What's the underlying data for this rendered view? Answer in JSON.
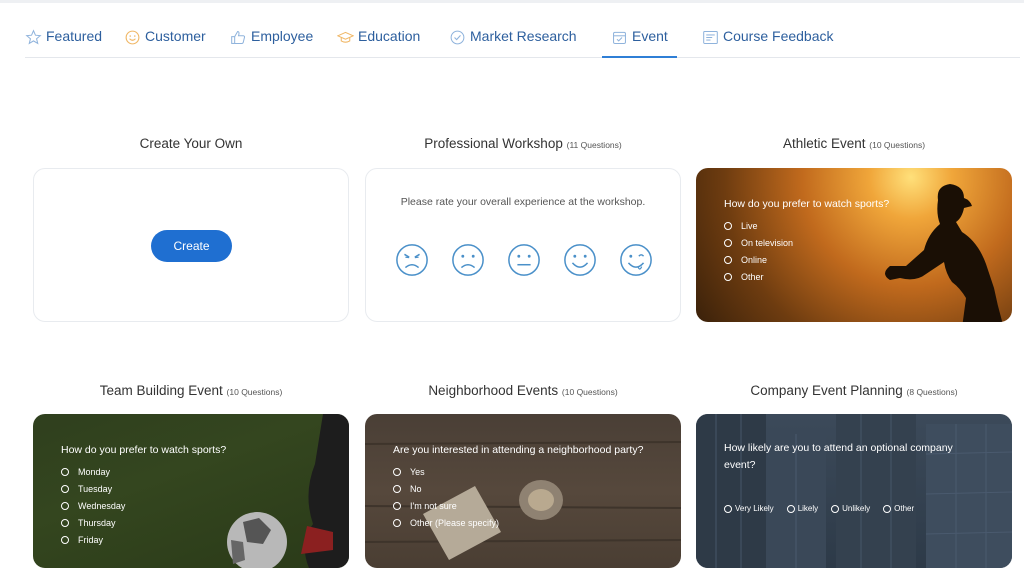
{
  "tabs": [
    {
      "label": "Featured",
      "icon": "star-icon"
    },
    {
      "label": "Customer",
      "icon": "smiley-icon"
    },
    {
      "label": "Employee",
      "icon": "thumbs-up-icon"
    },
    {
      "label": "Education",
      "icon": "graduation-cap-icon"
    },
    {
      "label": "Market Research",
      "icon": "checkmark-circle-icon"
    },
    {
      "label": "Event",
      "icon": "calendar-icon"
    },
    {
      "label": "Course Feedback",
      "icon": "form-icon"
    }
  ],
  "active_tab": "Event",
  "colors": {
    "accent": "#1f6fd1",
    "tab_text": "#2d5f9e",
    "face": "#4a90c9"
  },
  "cards": {
    "create": {
      "title": "Create Your Own",
      "button": "Create"
    },
    "workshop": {
      "title": "Professional Workshop",
      "count": "(11 Questions)",
      "question": "Please rate your overall experience at the workshop.",
      "faces": [
        "very-dissatisfied-face-icon",
        "dissatisfied-face-icon",
        "neutral-face-icon",
        "satisfied-face-icon",
        "very-satisfied-face-icon"
      ]
    },
    "athletic": {
      "title": "Athletic Event",
      "count": "(10 Questions)",
      "question": "How do you prefer to watch sports?",
      "options": [
        "Live",
        "On television",
        "Online",
        "Other"
      ]
    },
    "team": {
      "title": "Team Building Event",
      "count": "(10 Questions)",
      "question": "How do you prefer to watch sports?",
      "options": [
        "Monday",
        "Tuesday",
        "Wednesday",
        "Thursday",
        "Friday"
      ]
    },
    "neighborhood": {
      "title": "Neighborhood Events",
      "count": "(10 Questions)",
      "question": "Are you interested in attending a neighborhood party?",
      "options": [
        "Yes",
        "No",
        "I'm not sure",
        "Other (Please specify)"
      ]
    },
    "company": {
      "title": "Company Event Planning",
      "count": "(8 Questions)",
      "question": "How likely are you to attend an optional company event?",
      "options": [
        "Very Likely",
        "Likely",
        "Unlikely",
        "Other"
      ]
    }
  }
}
